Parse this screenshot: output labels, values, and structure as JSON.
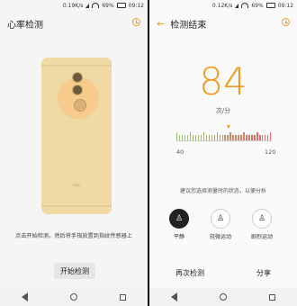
{
  "left": {
    "status": {
      "speed": "0.19K/s",
      "battery": "69%",
      "time": "09:12"
    },
    "title": "心率检测",
    "hint": "点击开始检测，然后将手指放置到指纹传感器上",
    "start_button": "开始检测",
    "icons": {
      "history": "history-icon"
    }
  },
  "right": {
    "status": {
      "speed": "0.12K/s",
      "battery": "69%",
      "time": "09:12"
    },
    "title": "检测结束",
    "bpm": "84",
    "unit": "次/分",
    "scale_min": "40",
    "scale_max": "120",
    "scale_value": 84,
    "state_hint": "建议您选择测量时的状态，以便分析",
    "states": [
      {
        "label": "平静",
        "icon": "person-standing-icon",
        "selected": true
      },
      {
        "label": "轻微运动",
        "icon": "person-walking-icon",
        "selected": false
      },
      {
        "label": "剧烈运动",
        "icon": "person-running-icon",
        "selected": false
      }
    ],
    "retest": "再次检测",
    "share": "分享"
  },
  "colors": {
    "accent": "#f19a1c",
    "scale_low": "#8fcf6a",
    "scale_high": "#f0606a"
  }
}
